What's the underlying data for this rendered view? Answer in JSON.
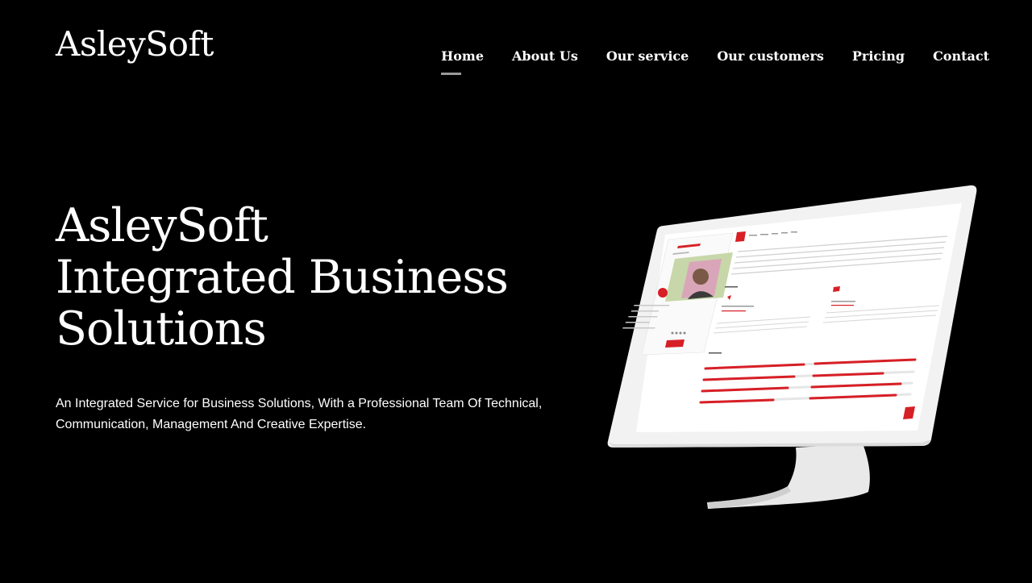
{
  "brand": {
    "logo_text": "AsleySoft"
  },
  "nav": {
    "items": [
      {
        "label": "Home",
        "active": true
      },
      {
        "label": "About Us"
      },
      {
        "label": "Our service"
      },
      {
        "label": "Our customers"
      },
      {
        "label": "Pricing"
      },
      {
        "label": "Contact"
      }
    ]
  },
  "hero": {
    "title_lines": [
      "AsleySoft",
      "Integrated Business",
      "Solutions"
    ],
    "subtitle": "An Integrated Service for Business Solutions, With a Professional Team Of Technical, Communication, Management And Creative Expertise."
  },
  "colors": {
    "background": "#000000",
    "text": "#ffffff",
    "accent": "#d71f26",
    "nav_underline": "#9a9a9a"
  }
}
